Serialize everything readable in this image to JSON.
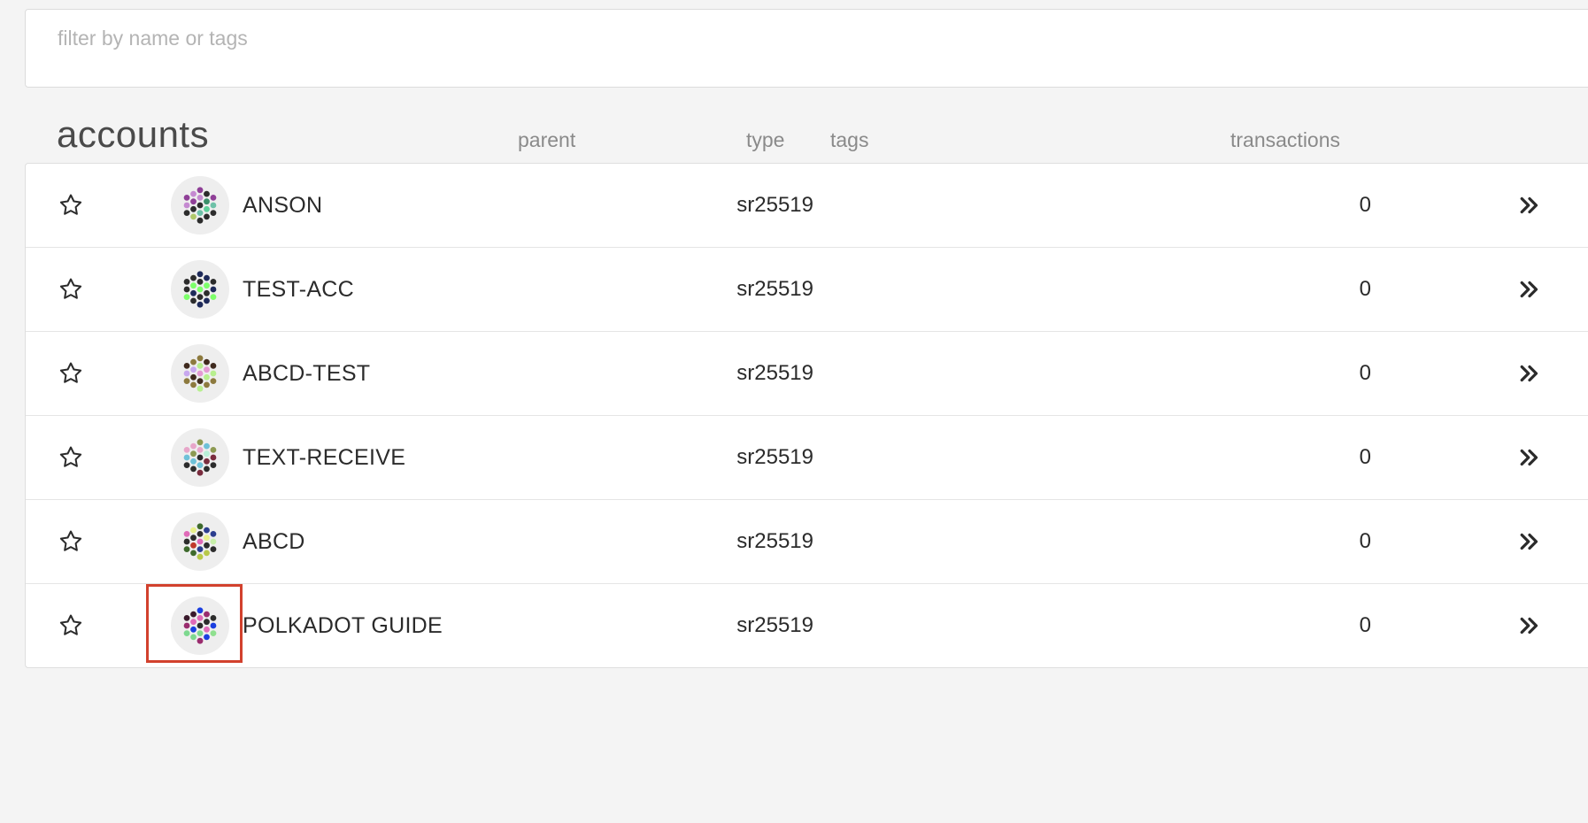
{
  "filter": {
    "placeholder": "filter by name or tags",
    "value": ""
  },
  "header": {
    "title": "accounts",
    "col_parent": "parent",
    "col_type": "type",
    "col_tags": "tags",
    "col_transactions": "transactions"
  },
  "icons": {
    "favorite": "star-outline-icon",
    "expand": "double-chevron-right-icon"
  },
  "colors": {
    "highlight": "#d2412d"
  },
  "accounts": [
    {
      "name": "ANSON",
      "type": "sr25519",
      "parent": "",
      "tags": "",
      "transactions": "0",
      "identicon": [
        "#8f3f97",
        "#c58ad1",
        "#2c2c2c",
        "#6ec1a8",
        "#2c2c2c",
        "#c58ad1",
        "#8f3f97",
        "#2c2c2c",
        "#b0c86a",
        "#2c2c2c",
        "#3b8f6a",
        "#5fcf9a",
        "#2c2c2c",
        "#8f3f97",
        "#c58ad1",
        "#2c2c2c",
        "#8f3f97",
        "#6ec1a8",
        "#2c2c2c"
      ]
    },
    {
      "name": "TEST-ACC",
      "type": "sr25519",
      "parent": "",
      "tags": "",
      "transactions": "0",
      "identicon": [
        "#1e2a5a",
        "#2c2c2c",
        "#7dff6a",
        "#2c2c2c",
        "#1e2a5a",
        "#2c2c2c",
        "#7dff6a",
        "#1e2a5a",
        "#2c2c2c",
        "#1e2a5a",
        "#7dff6a",
        "#2c2c2c",
        "#1e2a5a",
        "#2c2c2c",
        "#2c2c2c",
        "#7dff6a",
        "#2c2c2c",
        "#1e2a5a",
        "#7dff6a"
      ]
    },
    {
      "name": "ABCD-TEST",
      "type": "sr25519",
      "parent": "",
      "tags": "",
      "transactions": "0",
      "identicon": [
        "#8d7a3e",
        "#b7ef8e",
        "#e39ad3",
        "#3f2a1e",
        "#b7ef8e",
        "#8d7a3e",
        "#c8a8ef",
        "#3f2a1e",
        "#8d7a3e",
        "#3f2a1e",
        "#e39ad3",
        "#b7ef8e",
        "#8d7a3e",
        "#3f2a1e",
        "#c8a8ef",
        "#8d7a3e",
        "#3f2a1e",
        "#b7ef8e",
        "#8d7a3e"
      ]
    },
    {
      "name": "TEXT-RECEIVE",
      "type": "sr25519",
      "parent": "",
      "tags": "",
      "transactions": "0",
      "identicon": [
        "#8d9a52",
        "#e7a6c9",
        "#2c2c2c",
        "#6ec1d8",
        "#7a2c3e",
        "#e7a6c9",
        "#8d9a52",
        "#6ec1d8",
        "#2c2c2c",
        "#6ec1d8",
        "#b8f0d8",
        "#7a2c3e",
        "#2c2c2c",
        "#e7a6c9",
        "#6ec1d8",
        "#2c2c2c",
        "#8d9a52",
        "#7a2c3e",
        "#2c2c2c"
      ]
    },
    {
      "name": "ABCD",
      "type": "sr25519",
      "parent": "",
      "tags": "",
      "transactions": "0",
      "identicon": [
        "#3e6a2c",
        "#2c2c2c",
        "#e06ab8",
        "#2c3e8f",
        "#b7c84a",
        "#e8f08a",
        "#2c2c2c",
        "#c0392b",
        "#3e6a2c",
        "#2c3e8f",
        "#e8f08a",
        "#2c2c2c",
        "#b7c84a",
        "#e06ab8",
        "#2c2c2c",
        "#3e6a2c",
        "#2c3e8f",
        "#c8f0aa",
        "#2c2c2c"
      ]
    },
    {
      "name": "POLKADOT GUIDE",
      "type": "sr25519",
      "parent": "",
      "tags": "",
      "transactions": "0",
      "identicon": [
        "#1a3fe0",
        "#e06ab8",
        "#2c2c2c",
        "#7dd88f",
        "#9a2c6e",
        "#3a1a2c",
        "#e06ab8",
        "#1a3fe0",
        "#7dd88f",
        "#9a2c6e",
        "#2c2c2c",
        "#e06ab8",
        "#1a3fe0",
        "#3a1a2c",
        "#9a2c6e",
        "#7dd88f",
        "#2c2c2c",
        "#1a3fe0",
        "#8fe08f"
      ]
    }
  ]
}
